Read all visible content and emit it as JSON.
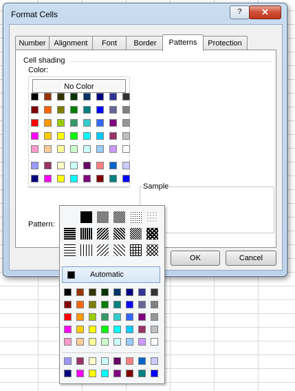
{
  "dialog": {
    "title": "Format Cells",
    "help_label": "?",
    "close_label": "✕",
    "tabs": [
      {
        "label": "Number"
      },
      {
        "label": "Alignment"
      },
      {
        "label": "Font"
      },
      {
        "label": "Border"
      },
      {
        "label": "Patterns"
      },
      {
        "label": "Protection"
      }
    ],
    "active_tab": "Patterns"
  },
  "patterns_tab": {
    "cell_shading_label": "Cell shading",
    "color_label": "Color:",
    "no_color_label": "No Color",
    "sample_label": "Sample",
    "pattern_label": "Pattern:",
    "pattern_value": "",
    "palette_rows": [
      [
        "#000000",
        "#993300",
        "#333300",
        "#003300",
        "#003366",
        "#000080",
        "#333399",
        "#333333"
      ],
      [
        "#800000",
        "#ff6600",
        "#808000",
        "#008000",
        "#008080",
        "#0000ff",
        "#666699",
        "#808080"
      ],
      [
        "#ff0000",
        "#ff9900",
        "#99cc00",
        "#339966",
        "#33cccc",
        "#3366ff",
        "#800080",
        "#969696"
      ],
      [
        "#ff00ff",
        "#ffcc00",
        "#ffff00",
        "#00ff00",
        "#00ffff",
        "#00ccff",
        "#993366",
        "#c0c0c0"
      ],
      [
        "#ff99cc",
        "#ffcc99",
        "#ffff99",
        "#ccffcc",
        "#ccffff",
        "#99ccff",
        "#cc99ff",
        "#ffffff"
      ]
    ],
    "extra_rows": [
      [
        "#9999ff",
        "#993366",
        "#ffffcc",
        "#ccffff",
        "#660066",
        "#ff8080",
        "#0066cc",
        "#ccccff"
      ],
      [
        "#000080",
        "#ff00ff",
        "#ffff00",
        "#00ffff",
        "#800080",
        "#800000",
        "#008080",
        "#0000ff"
      ]
    ]
  },
  "buttons": {
    "ok_label": "OK",
    "cancel_label": "Cancel"
  },
  "pattern_dropdown": {
    "automatic_label": "Automatic",
    "patterns": [
      [
        "solid",
        "dense-dots",
        "medium-dots",
        "light-dots",
        "sparse-dots"
      ],
      [
        "horizontal-lines",
        "vertical-lines",
        "reverse-diagonal",
        "diagonal",
        "diagonal-crosshatch",
        "thick-crosshatch"
      ],
      [
        "thin-horizontal",
        "thin-vertical",
        "thin-reverse-diagonal",
        "thin-diagonal",
        "thin-crosshatch",
        "thin-diagonal-crosshatch"
      ]
    ]
  }
}
